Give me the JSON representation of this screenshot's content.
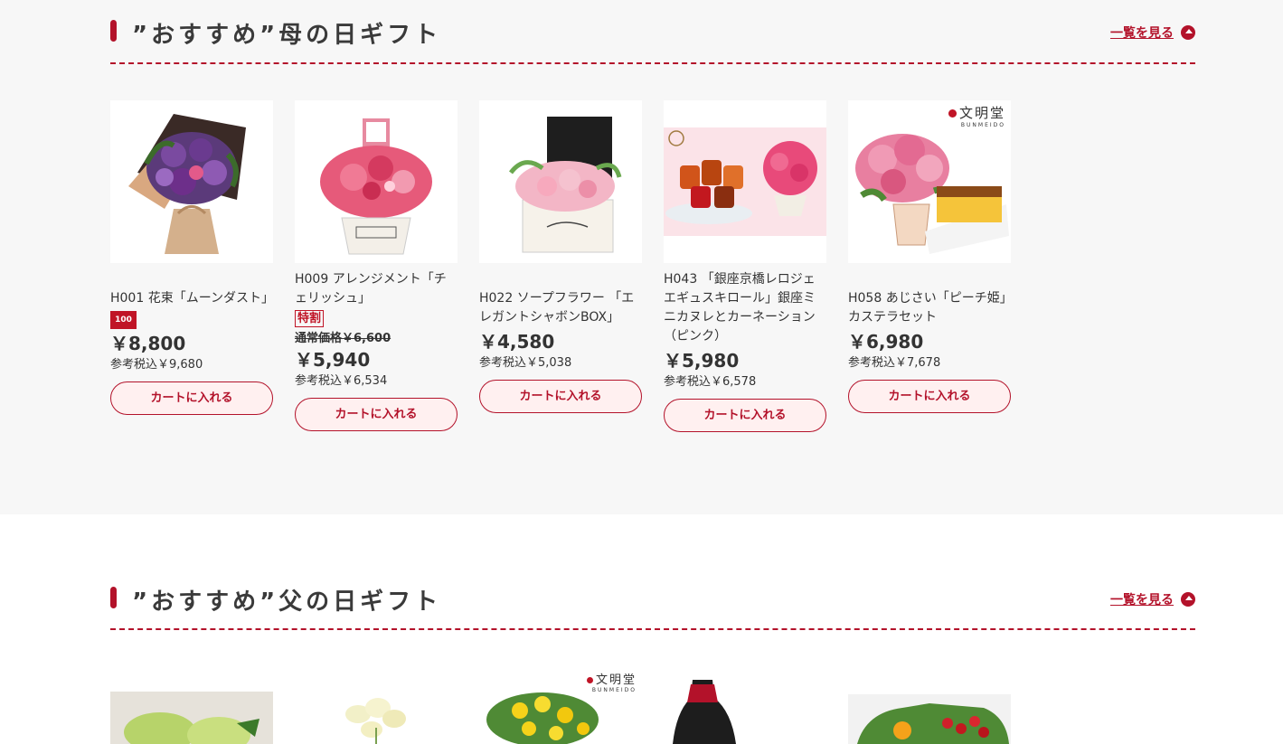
{
  "mother": {
    "title": "”おすすめ”母の日ギフト",
    "more_label": "一覧を見る",
    "products": [
      {
        "name": "H001 花束「ムーンダスト」",
        "badge": "100",
        "price": "￥8,800",
        "tax": "参考税込￥9,680",
        "cart": "カートに入れる"
      },
      {
        "name": "H009 アレンジメント「チェリッシュ」",
        "badge": "特割",
        "original_price": "通常価格￥6,600",
        "price": "￥5,940",
        "tax": "参考税込￥6,534",
        "cart": "カートに入れる"
      },
      {
        "name": "H022 ソープフラワー 「エレガントシャボンBOX」",
        "price": "￥4,580",
        "tax": "参考税込￥5,038",
        "cart": "カートに入れる"
      },
      {
        "name": "H043 「銀座京橋レロジェエギュスキロール」銀座ミニカヌレとカーネーション（ピンク）",
        "price": "￥5,980",
        "tax": "参考税込￥6,578",
        "cart": "カートに入れる"
      },
      {
        "name": "H058 あじさい「ピーチ姫」カステラセット",
        "price": "￥6,980",
        "tax": "参考税込￥7,678",
        "cart": "カートに入れる",
        "brand": "文明堂",
        "brand_sub": "BUNMEIDO"
      }
    ]
  },
  "father": {
    "title": "”おすすめ”父の日ギフト",
    "more_label": "一覧を見る",
    "brand": "文明堂",
    "brand_sub": "BUNMEIDO"
  },
  "colors": {
    "accent": "#b3122a",
    "cart_bg": "#fff0f0",
    "section_bg": "#f7f7f7"
  }
}
